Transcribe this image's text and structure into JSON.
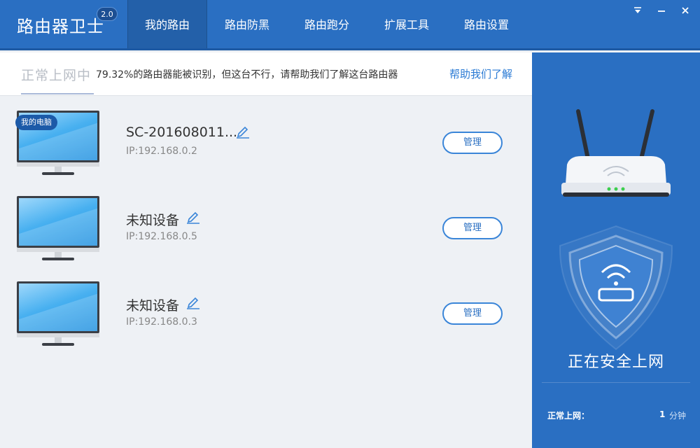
{
  "app": {
    "title": "路由器卫士",
    "version": "2.0"
  },
  "nav": {
    "tabs": [
      {
        "label": "我的路由",
        "active": true
      },
      {
        "label": "路由防黑",
        "active": false
      },
      {
        "label": "路由跑分",
        "active": false
      },
      {
        "label": "扩展工具",
        "active": false
      },
      {
        "label": "路由设置",
        "active": false
      }
    ]
  },
  "window_controls": {
    "menu_icon": "dropdown-icon",
    "minimize_icon": "minimize-icon",
    "close_icon": "close-icon"
  },
  "notice": {
    "status": "正常上网中",
    "message": "79.32%的路由器能被识别，但这台不行，请帮助我们了解这台路由器",
    "help_link": "帮助我们了解"
  },
  "devices": [
    {
      "badge": "我的电脑",
      "name": "SC-201608011...",
      "ip": "IP:192.168.0.2",
      "manage_label": "管理"
    },
    {
      "name": "未知设备",
      "ip": "IP:192.168.0.5",
      "manage_label": "管理"
    },
    {
      "name": "未知设备",
      "ip": "IP:192.168.0.3",
      "manage_label": "管理"
    }
  ],
  "side": {
    "status": "正在安全上网",
    "online_label": "正常上网：",
    "online_value": "1",
    "online_unit": "分钟"
  },
  "colors": {
    "header": "#2a6fc2",
    "accent": "#3a85d8",
    "side": "#2a6fc2"
  }
}
